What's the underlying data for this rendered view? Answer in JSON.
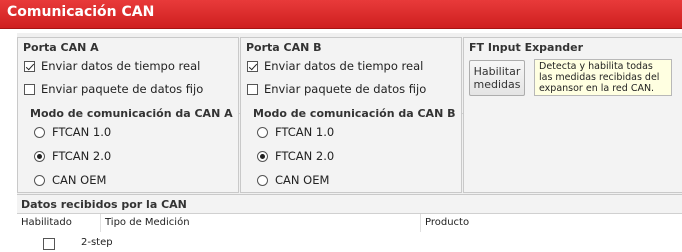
{
  "window": {
    "title": "Comunicación CAN"
  },
  "panels": [
    {
      "title": "Porta CAN A",
      "send_realtime": {
        "label": "Enviar datos de tiempo real",
        "checked": true
      },
      "send_fixed": {
        "label": "Enviar paquete de datos fijo",
        "checked": false
      },
      "mode_group": "Modo de comunicación da CAN A",
      "modes": [
        {
          "label": "FTCAN 1.0",
          "selected": false
        },
        {
          "label": "FTCAN 2.0",
          "selected": true
        },
        {
          "label": "CAN OEM",
          "selected": false
        }
      ]
    },
    {
      "title": "Porta CAN B",
      "send_realtime": {
        "label": "Enviar datos de tiempo real",
        "checked": true
      },
      "send_fixed": {
        "label": "Enviar paquete de datos fijo",
        "checked": false
      },
      "mode_group": "Modo de comunicación da CAN B",
      "modes": [
        {
          "label": "FTCAN 1.0",
          "selected": false
        },
        {
          "label": "FTCAN 2.0",
          "selected": true
        },
        {
          "label": "CAN OEM",
          "selected": false
        }
      ]
    }
  ],
  "expander": {
    "title": "FT Input Expander",
    "button_label": "Habilitar\nmedidas",
    "tooltip": "Detecta y habilita todas las medidas recibidas del expansor en la red CAN."
  },
  "received": {
    "title": "Datos recibidos por la CAN",
    "columns": [
      "Habilitado",
      "Tipo de Medición",
      "Producto"
    ],
    "rows": [
      {
        "enabled": false,
        "type": "2-step",
        "product": ""
      }
    ]
  }
}
